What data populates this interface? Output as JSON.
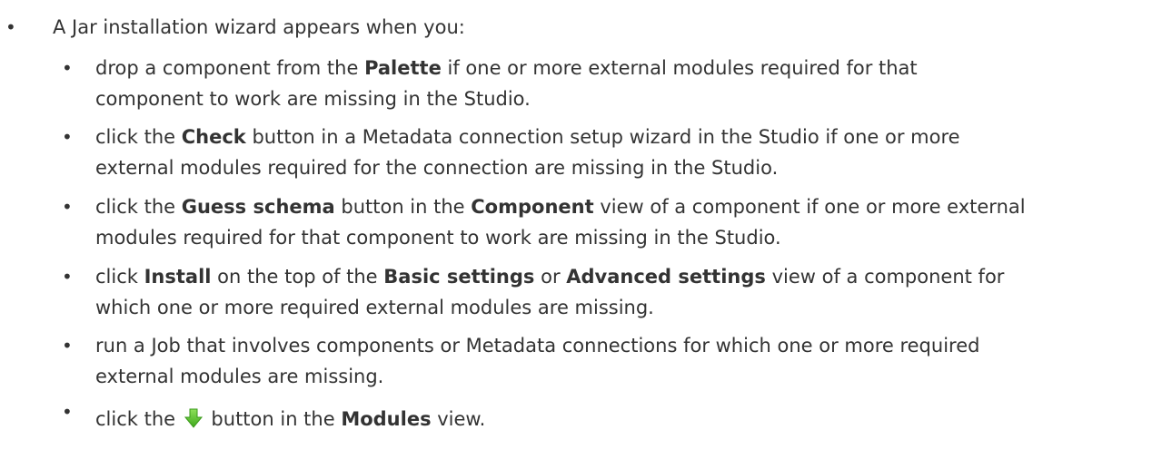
{
  "intro": "A Jar installation wizard appears when you:",
  "items": [
    {
      "l1a": "drop a component from the ",
      "l1b": "Palette",
      "l1c": " if one or more external modules required for that",
      "l2": "component to work are missing in the Studio."
    },
    {
      "l1a": "click the ",
      "l1b": "Check",
      "l1c": " button in a Metadata connection setup wizard in the Studio if one or more",
      "l2": "external modules required for the connection are missing in the Studio."
    },
    {
      "l1a": "click the ",
      "l1b": "Guess schema",
      "l1c": " button in the ",
      "l1d": "Component",
      "l1e": " view of a component if one or more external",
      "l2": "modules required for that component to work are missing in the Studio."
    },
    {
      "l1a": "click ",
      "l1b": "Install",
      "l1c": " on the top of the ",
      "l1d": "Basic settings",
      "l1e": " or ",
      "l1f": "Advanced settings",
      "l1g": " view of a component for",
      "l2": "which one or more required external modules are missing."
    },
    {
      "l1": "run a Job that involves components or Metadata connections for which one or more required",
      "l2": "external modules are missing."
    },
    {
      "l1a": "click the ",
      "icon": "download-arrow-icon",
      "l1b": " button in the ",
      "l1c": "Modules",
      "l1d": " view."
    }
  ],
  "bullet": "•",
  "colors": {
    "text": "#333333",
    "icon_green": "#5cbf2a"
  }
}
